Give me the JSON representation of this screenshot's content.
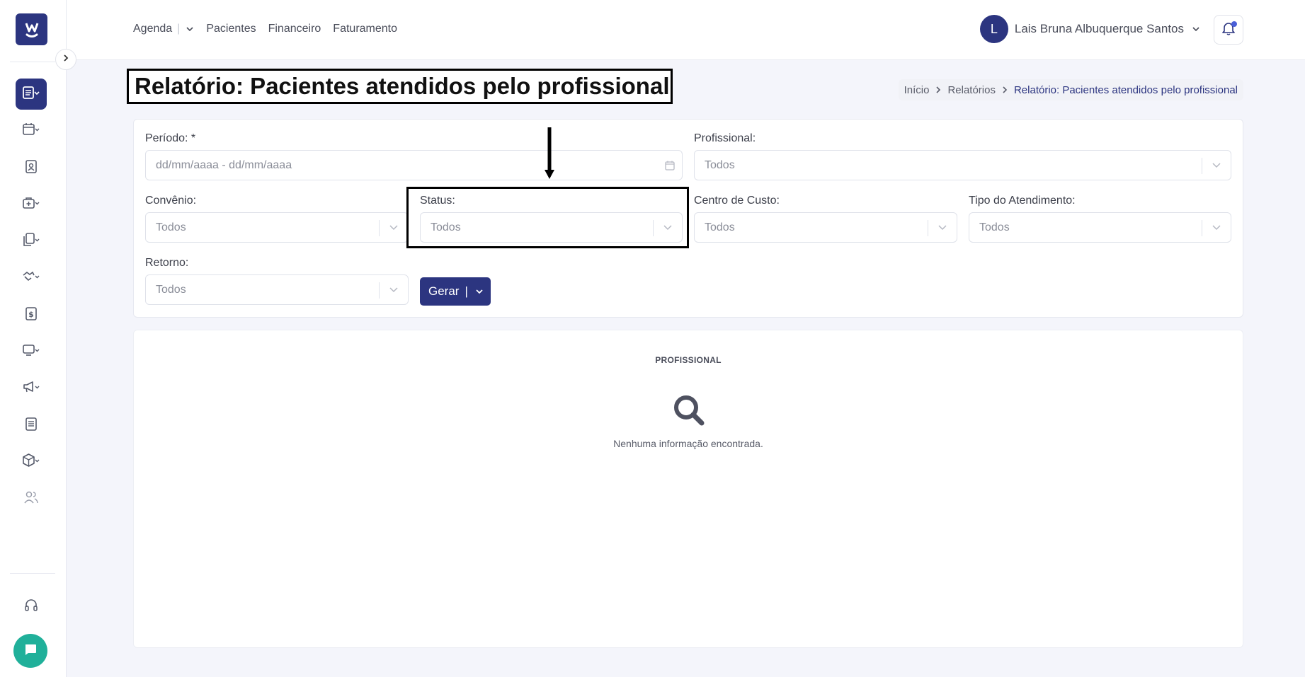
{
  "nav": {
    "items": [
      "Agenda",
      "Pacientes",
      "Financeiro",
      "Faturamento"
    ],
    "agenda_sep": "|"
  },
  "user": {
    "initial": "L",
    "name": "Lais Bruna Albuquerque Santos"
  },
  "page": {
    "title": "Relatório: Pacientes atendidos pelo profissional"
  },
  "breadcrumb": [
    "Início",
    "Relatórios",
    "Relatório: Pacientes atendidos pelo profissional"
  ],
  "filters": {
    "periodo": {
      "label": "Período: *",
      "placeholder": "dd/mm/aaaa - dd/mm/aaaa"
    },
    "profissional": {
      "label": "Profissional:",
      "value": "Todos"
    },
    "convenio": {
      "label": "Convênio:",
      "value": "Todos"
    },
    "status": {
      "label": "Status:",
      "value": "Todos"
    },
    "centro_custo": {
      "label": "Centro de Custo:",
      "value": "Todos"
    },
    "tipo_atendimento": {
      "label": "Tipo do Atendimento:",
      "value": "Todos"
    },
    "retorno": {
      "label": "Retorno:",
      "value": "Todos"
    }
  },
  "actions": {
    "gerar_label": "Gerar",
    "gerar_pipe": "|"
  },
  "results": {
    "heading": "PROFISSIONAL",
    "empty_text": "Nenhuma informação encontrada."
  },
  "colors": {
    "primary": "#2c3580",
    "chat": "#20b09a",
    "notification_dot": "#4a5fd8"
  },
  "sidebar_icons": [
    "reports-icon",
    "calendar-icon",
    "patient-card-icon",
    "medical-bag-icon",
    "documents-icon",
    "handshake-icon",
    "dollar-icon",
    "monitor-icon",
    "megaphone-icon",
    "news-icon",
    "box-icon",
    "users-icon",
    "headset-icon",
    "chat-icon"
  ]
}
